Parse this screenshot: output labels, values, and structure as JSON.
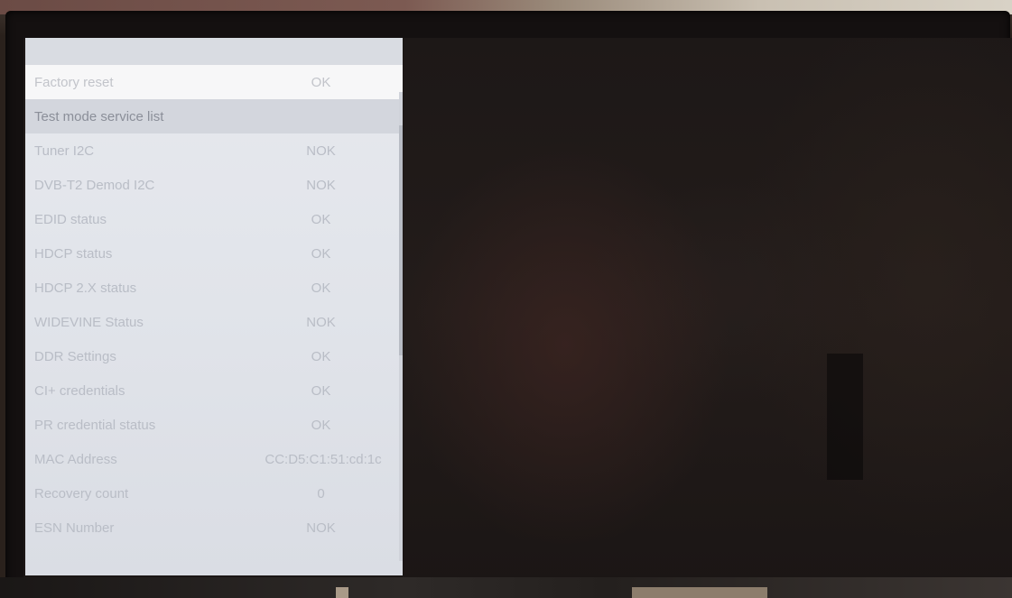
{
  "menu": {
    "rows": [
      {
        "label": "Factory reset",
        "value": "OK"
      },
      {
        "label": "Test mode service list",
        "value": ""
      },
      {
        "label": "Tuner I2C",
        "value": "NOK"
      },
      {
        "label": "DVB-T2 Demod I2C",
        "value": "NOK"
      },
      {
        "label": "EDID status",
        "value": "OK"
      },
      {
        "label": "HDCP status",
        "value": "OK"
      },
      {
        "label": "HDCP 2.X status",
        "value": "OK"
      },
      {
        "label": "WIDEVINE Status",
        "value": "NOK"
      },
      {
        "label": "DDR Settings",
        "value": "OK"
      },
      {
        "label": "CI+ credentials",
        "value": "OK"
      },
      {
        "label": "PR credential status",
        "value": "OK"
      },
      {
        "label": "MAC Address",
        "value": "CC:D5:C1:51:cd:1c"
      },
      {
        "label": "Recovery count",
        "value": "0"
      },
      {
        "label": "ESN Number",
        "value": "NOK"
      }
    ]
  },
  "colors": {
    "panel_bg": "#e3e6eb",
    "selected_bg": "#f7f7f8",
    "header_bg": "#d3d6dd",
    "text": "#b9bdc6",
    "screen_bg": "#1f1a18"
  }
}
